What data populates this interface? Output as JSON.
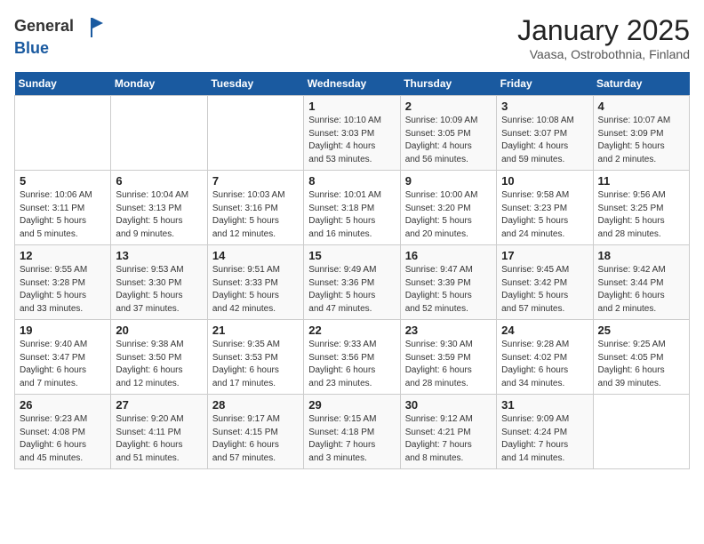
{
  "header": {
    "logo_line1": "General",
    "logo_line2": "Blue",
    "month": "January 2025",
    "location": "Vaasa, Ostrobothnia, Finland"
  },
  "weekdays": [
    "Sunday",
    "Monday",
    "Tuesday",
    "Wednesday",
    "Thursday",
    "Friday",
    "Saturday"
  ],
  "weeks": [
    [
      {
        "day": "",
        "info": ""
      },
      {
        "day": "",
        "info": ""
      },
      {
        "day": "",
        "info": ""
      },
      {
        "day": "1",
        "info": "Sunrise: 10:10 AM\nSunset: 3:03 PM\nDaylight: 4 hours\nand 53 minutes."
      },
      {
        "day": "2",
        "info": "Sunrise: 10:09 AM\nSunset: 3:05 PM\nDaylight: 4 hours\nand 56 minutes."
      },
      {
        "day": "3",
        "info": "Sunrise: 10:08 AM\nSunset: 3:07 PM\nDaylight: 4 hours\nand 59 minutes."
      },
      {
        "day": "4",
        "info": "Sunrise: 10:07 AM\nSunset: 3:09 PM\nDaylight: 5 hours\nand 2 minutes."
      }
    ],
    [
      {
        "day": "5",
        "info": "Sunrise: 10:06 AM\nSunset: 3:11 PM\nDaylight: 5 hours\nand 5 minutes."
      },
      {
        "day": "6",
        "info": "Sunrise: 10:04 AM\nSunset: 3:13 PM\nDaylight: 5 hours\nand 9 minutes."
      },
      {
        "day": "7",
        "info": "Sunrise: 10:03 AM\nSunset: 3:16 PM\nDaylight: 5 hours\nand 12 minutes."
      },
      {
        "day": "8",
        "info": "Sunrise: 10:01 AM\nSunset: 3:18 PM\nDaylight: 5 hours\nand 16 minutes."
      },
      {
        "day": "9",
        "info": "Sunrise: 10:00 AM\nSunset: 3:20 PM\nDaylight: 5 hours\nand 20 minutes."
      },
      {
        "day": "10",
        "info": "Sunrise: 9:58 AM\nSunset: 3:23 PM\nDaylight: 5 hours\nand 24 minutes."
      },
      {
        "day": "11",
        "info": "Sunrise: 9:56 AM\nSunset: 3:25 PM\nDaylight: 5 hours\nand 28 minutes."
      }
    ],
    [
      {
        "day": "12",
        "info": "Sunrise: 9:55 AM\nSunset: 3:28 PM\nDaylight: 5 hours\nand 33 minutes."
      },
      {
        "day": "13",
        "info": "Sunrise: 9:53 AM\nSunset: 3:30 PM\nDaylight: 5 hours\nand 37 minutes."
      },
      {
        "day": "14",
        "info": "Sunrise: 9:51 AM\nSunset: 3:33 PM\nDaylight: 5 hours\nand 42 minutes."
      },
      {
        "day": "15",
        "info": "Sunrise: 9:49 AM\nSunset: 3:36 PM\nDaylight: 5 hours\nand 47 minutes."
      },
      {
        "day": "16",
        "info": "Sunrise: 9:47 AM\nSunset: 3:39 PM\nDaylight: 5 hours\nand 52 minutes."
      },
      {
        "day": "17",
        "info": "Sunrise: 9:45 AM\nSunset: 3:42 PM\nDaylight: 5 hours\nand 57 minutes."
      },
      {
        "day": "18",
        "info": "Sunrise: 9:42 AM\nSunset: 3:44 PM\nDaylight: 6 hours\nand 2 minutes."
      }
    ],
    [
      {
        "day": "19",
        "info": "Sunrise: 9:40 AM\nSunset: 3:47 PM\nDaylight: 6 hours\nand 7 minutes."
      },
      {
        "day": "20",
        "info": "Sunrise: 9:38 AM\nSunset: 3:50 PM\nDaylight: 6 hours\nand 12 minutes."
      },
      {
        "day": "21",
        "info": "Sunrise: 9:35 AM\nSunset: 3:53 PM\nDaylight: 6 hours\nand 17 minutes."
      },
      {
        "day": "22",
        "info": "Sunrise: 9:33 AM\nSunset: 3:56 PM\nDaylight: 6 hours\nand 23 minutes."
      },
      {
        "day": "23",
        "info": "Sunrise: 9:30 AM\nSunset: 3:59 PM\nDaylight: 6 hours\nand 28 minutes."
      },
      {
        "day": "24",
        "info": "Sunrise: 9:28 AM\nSunset: 4:02 PM\nDaylight: 6 hours\nand 34 minutes."
      },
      {
        "day": "25",
        "info": "Sunrise: 9:25 AM\nSunset: 4:05 PM\nDaylight: 6 hours\nand 39 minutes."
      }
    ],
    [
      {
        "day": "26",
        "info": "Sunrise: 9:23 AM\nSunset: 4:08 PM\nDaylight: 6 hours\nand 45 minutes."
      },
      {
        "day": "27",
        "info": "Sunrise: 9:20 AM\nSunset: 4:11 PM\nDaylight: 6 hours\nand 51 minutes."
      },
      {
        "day": "28",
        "info": "Sunrise: 9:17 AM\nSunset: 4:15 PM\nDaylight: 6 hours\nand 57 minutes."
      },
      {
        "day": "29",
        "info": "Sunrise: 9:15 AM\nSunset: 4:18 PM\nDaylight: 7 hours\nand 3 minutes."
      },
      {
        "day": "30",
        "info": "Sunrise: 9:12 AM\nSunset: 4:21 PM\nDaylight: 7 hours\nand 8 minutes."
      },
      {
        "day": "31",
        "info": "Sunrise: 9:09 AM\nSunset: 4:24 PM\nDaylight: 7 hours\nand 14 minutes."
      },
      {
        "day": "",
        "info": ""
      }
    ]
  ]
}
